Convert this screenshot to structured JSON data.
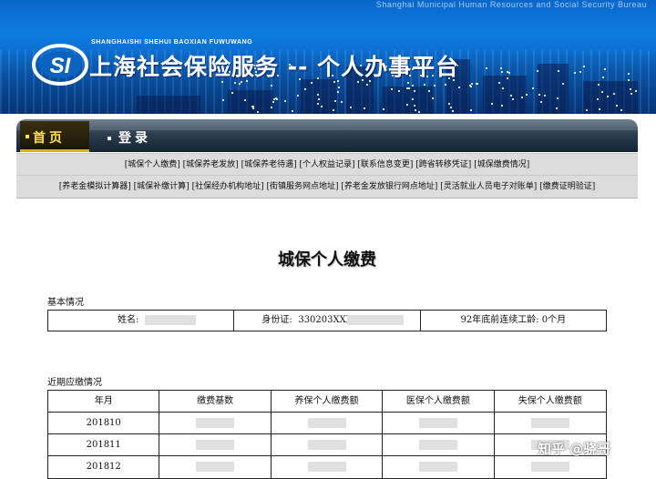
{
  "banner": {
    "top_text": "Shanghai Municipal Human Resources and Social Security Bureau",
    "pinyin": "SHANGHAISHI SHEHUI BAOXIAN FUWUWANG",
    "logo_text": "SI",
    "title": "上海社会保险服务 -- 个人办事平台"
  },
  "nav": {
    "home": "首页",
    "login": "登录"
  },
  "links_row1": [
    "[城保个人缴费]",
    "[城保养老发放]",
    "[城保养老待遇]",
    "[个人权益记录]",
    "[联系信息变更]",
    "[跨省转移凭证]",
    "[城保缴费情况]"
  ],
  "links_row2": [
    "[养老金模拟计算器]",
    "[城保补缴计算]",
    "[社保经办机构地址]",
    "[街镇服务网点地址]",
    "[养老金发放银行网点地址]",
    "[灵活就业人员电子对账单]",
    "[缴费证明验证]"
  ],
  "page_title": "城保个人缴费",
  "basic": {
    "section": "基本情况",
    "name_label": "姓名:",
    "id_label": "身份证:",
    "id_prefix": "330203XXX",
    "seniority": "92年底前连续工龄: 0个月"
  },
  "payments": {
    "section": "近期应缴情况",
    "headers": [
      "年月",
      "缴费基数",
      "养保个人缴费额",
      "医保个人缴费额",
      "失保个人缴费额"
    ],
    "rows": [
      "201810",
      "201811",
      "201812"
    ]
  },
  "watermark": "知乎 @骁哥",
  "colors": {
    "banner_blue": "#0b6fd0",
    "nav_dark": "#1d2e3d",
    "nav_active": "#ffe34a",
    "link_row_bg": "#dcdcdc"
  }
}
